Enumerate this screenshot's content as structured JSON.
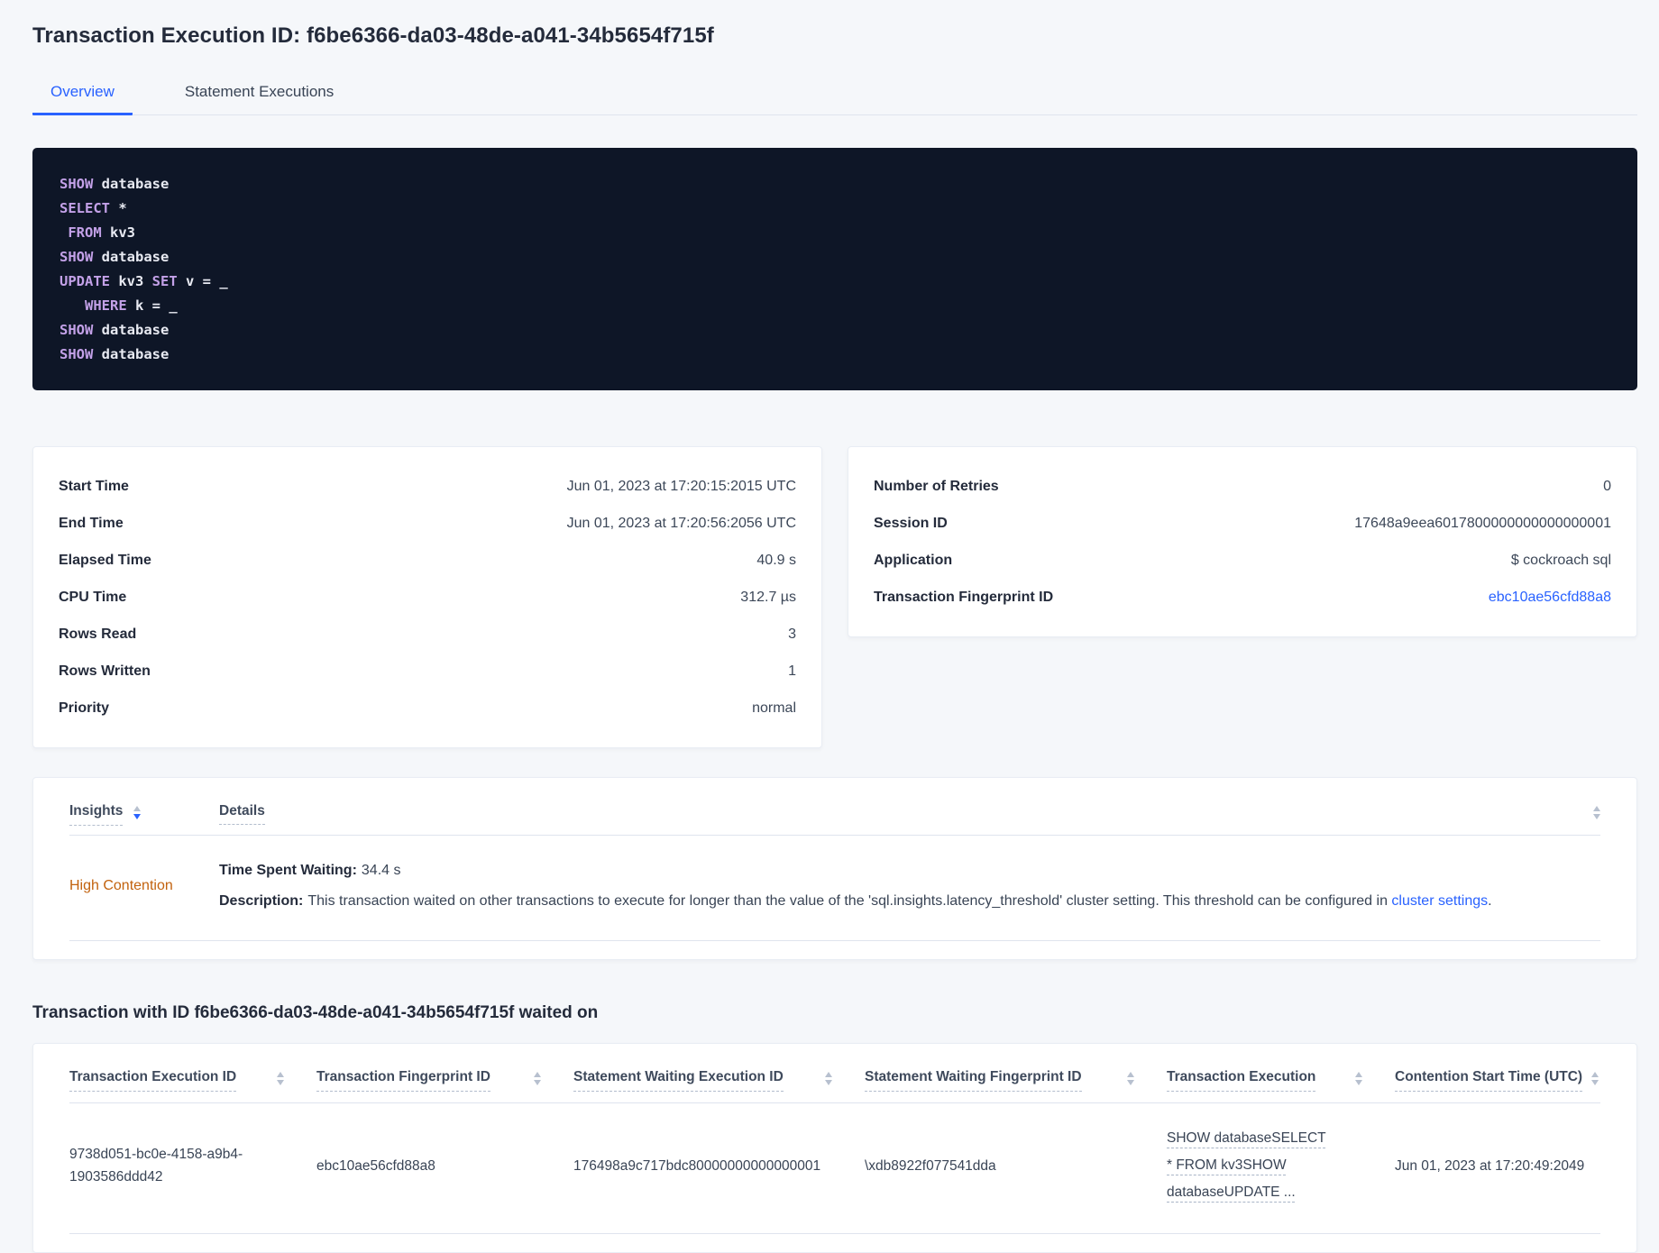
{
  "page_title": "Transaction Execution ID: f6be6366-da03-48de-a041-34b5654f715f",
  "tabs": {
    "items": [
      {
        "label": "Overview",
        "active": true
      },
      {
        "label": "Statement Executions",
        "active": false
      }
    ]
  },
  "sql_box": {
    "lines": [
      [
        {
          "kw": true,
          "s": "SHOW"
        },
        {
          "kw": false,
          "s": " database"
        }
      ],
      [
        {
          "kw": true,
          "s": "SELECT"
        },
        {
          "kw": false,
          "s": " *"
        }
      ],
      [
        {
          "kw": false,
          "s": " "
        },
        {
          "kw": true,
          "s": "FROM"
        },
        {
          "kw": false,
          "s": " kv3"
        }
      ],
      [
        {
          "kw": true,
          "s": "SHOW"
        },
        {
          "kw": false,
          "s": " database"
        }
      ],
      [
        {
          "kw": true,
          "s": "UPDATE"
        },
        {
          "kw": false,
          "s": " kv3 "
        },
        {
          "kw": true,
          "s": "SET"
        },
        {
          "kw": false,
          "s": " v = _"
        }
      ],
      [
        {
          "kw": false,
          "s": "   "
        },
        {
          "kw": true,
          "s": "WHERE"
        },
        {
          "kw": false,
          "s": " k = _"
        }
      ],
      [
        {
          "kw": true,
          "s": "SHOW"
        },
        {
          "kw": false,
          "s": " database"
        }
      ],
      [
        {
          "kw": true,
          "s": "SHOW"
        },
        {
          "kw": false,
          "s": " database"
        }
      ]
    ]
  },
  "summary": {
    "left": {
      "rows": [
        {
          "label": "Start Time",
          "value": "Jun 01, 2023 at 17:20:15:2015 UTC"
        },
        {
          "label": "End Time",
          "value": "Jun 01, 2023 at 17:20:56:2056 UTC"
        },
        {
          "label": "Elapsed Time",
          "value": "40.9 s"
        },
        {
          "label": "CPU Time",
          "value": "312.7 µs"
        },
        {
          "label": "Rows Read",
          "value": "3"
        },
        {
          "label": "Rows Written",
          "value": "1"
        },
        {
          "label": "Priority",
          "value": "normal"
        }
      ]
    },
    "right": {
      "rows": [
        {
          "label": "Number of Retries",
          "value": "0"
        },
        {
          "label": "Session ID",
          "value": "17648a9eea6017800000000000000001"
        },
        {
          "label": "Application",
          "value": "$ cockroach sql"
        },
        {
          "label": "Transaction Fingerprint ID",
          "value": "ebc10ae56cfd88a8",
          "link": true
        }
      ]
    }
  },
  "insights": {
    "col_insights": "Insights",
    "col_details": "Details",
    "row": {
      "name": "High Contention",
      "waiting_label": "Time Spent Waiting:",
      "waiting_value": "34.4 s",
      "desc_label": "Description:",
      "desc_text": "This transaction waited on other transactions to execute for longer than the value of the 'sql.insights.latency_threshold' cluster setting. This threshold can be configured in ",
      "desc_link": "cluster settings",
      "desc_suffix": "."
    }
  },
  "waited_section": {
    "heading": "Transaction with ID f6be6366-da03-48de-a041-34b5654f715f waited on",
    "columns": [
      "Transaction Execution ID",
      "Transaction Fingerprint ID",
      "Statement Waiting Execution ID",
      "Statement Waiting Fingerprint ID",
      "Transaction Execution",
      "Contention Start Time (UTC)"
    ],
    "row": {
      "transaction_execution_id": "9738d051-bc0e-4158-a9b4-1903586ddd42",
      "transaction_fingerprint_id": "ebc10ae56cfd88a8",
      "statement_waiting_execution_id": "176498a9c717bdc80000000000000001",
      "statement_waiting_fingerprint_id": "\\xdb8922f077541dda",
      "transaction_execution": "SHOW databaseSELECT * FROM kv3SHOW databaseUPDATE ...",
      "contention_start_time": "Jun 01, 2023 at 17:20:49:2049"
    }
  },
  "colors": {
    "accent_blue": "#2962ff",
    "insight_orange": "#c2620e",
    "code_background": "#0e1627",
    "code_keyword": "#c3a1e8"
  }
}
